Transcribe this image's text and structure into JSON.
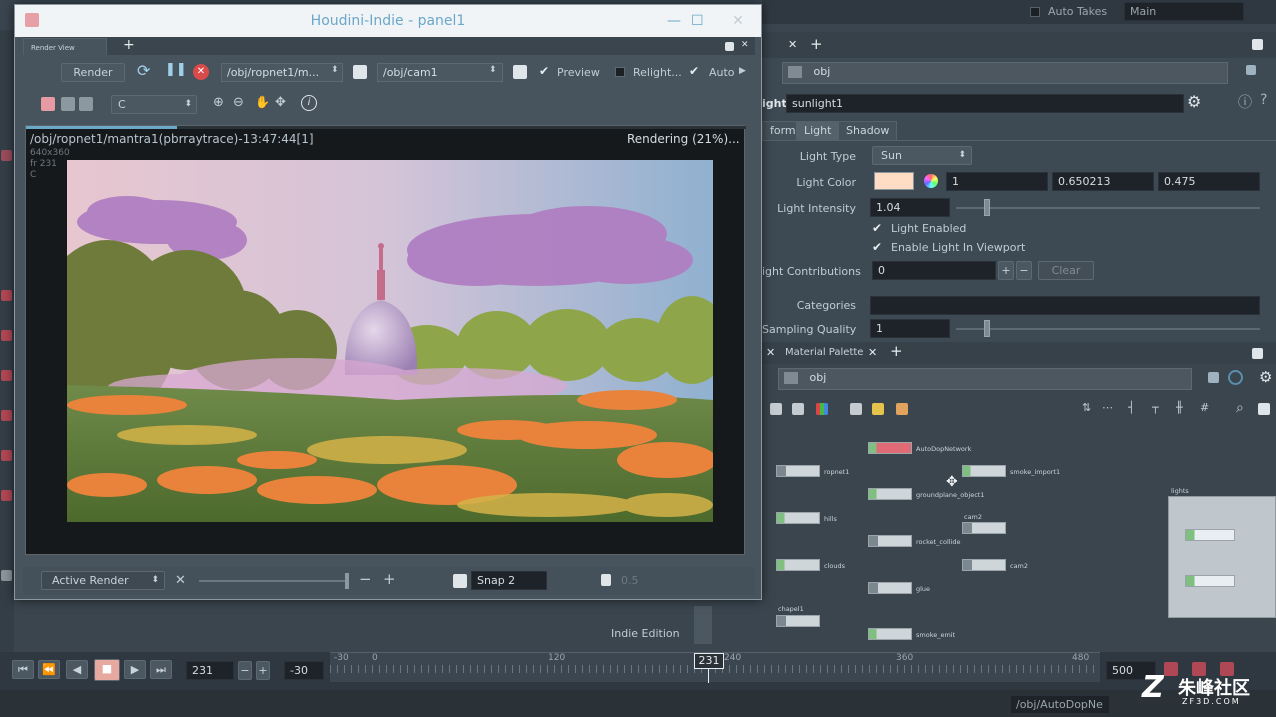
{
  "top_bar": {
    "auto_takes": "Auto Takes",
    "main": "Main"
  },
  "render_window": {
    "title": "Houdini-Indie - panel1",
    "pane_tab": "Render View",
    "toolbar": {
      "render_label": "Render",
      "rop_path": "/obj/ropnet1/m...",
      "camera_path": "/obj/cam1",
      "preview_label": "Preview",
      "relight_label": "Relight...",
      "auto_label": "Auto"
    },
    "channel": "C",
    "render_status": {
      "path": "/obj/ropnet1/mantra1(pbrraytrace)-13:47:44[1]",
      "progress_text": "Rendering (21%)...",
      "resolution": "640x360",
      "frame": "fr 231",
      "channel": "C"
    },
    "bottom_bar": {
      "active_render": "Active Render",
      "snap_label": "Snap 2",
      "value": "0.5"
    }
  },
  "parameter_pane": {
    "path": "obj",
    "node_type_label": "ight",
    "node_name": "sunlight1",
    "tabs": [
      "form",
      "Light",
      "Shadow"
    ],
    "light_type_label": "Light Type",
    "light_type_value": "Sun",
    "light_color_label": "Light Color",
    "light_color_r": "1",
    "light_color_g": "0.650213",
    "light_color_b": "0.475",
    "light_intensity_label": "Light Intensity",
    "light_intensity_value": "1.04",
    "light_enabled": "Light Enabled",
    "enable_in_viewport": "Enable Light In Viewport",
    "light_contributions_label": "ight Contributions",
    "light_contributions_value": "0",
    "clear_label": "Clear",
    "categories_label": "Categories",
    "sampling_quality_label": "Sampling Quality",
    "sampling_quality_value": "1"
  },
  "network_pane": {
    "tab": "Material Palette",
    "path": "obj",
    "nodes": [
      {
        "label": "AutoDopNetwork"
      },
      {
        "label": "ropnet1"
      },
      {
        "label": "smoke_import1"
      },
      {
        "label": "groundplane_object1"
      },
      {
        "label": "hills"
      },
      {
        "label": "cam2"
      },
      {
        "label": "rocket_collide"
      },
      {
        "label": "clouds"
      },
      {
        "label": "cam2"
      },
      {
        "label": "glue"
      },
      {
        "label": "chapel1"
      },
      {
        "label": "smoke_emit"
      }
    ],
    "group_label": "lights"
  },
  "status": {
    "edition": "Indie Edition"
  },
  "timeline": {
    "current_frame": "231",
    "start_field": "-30",
    "ticks": [
      "-30",
      "0",
      "120",
      "240",
      "360",
      "480"
    ],
    "playhead_frame": "231",
    "end_field": "500",
    "path": "/obj/AutoDopNe"
  },
  "watermark": {
    "text": "朱峰社区",
    "sub": "ZF3D.COM"
  }
}
